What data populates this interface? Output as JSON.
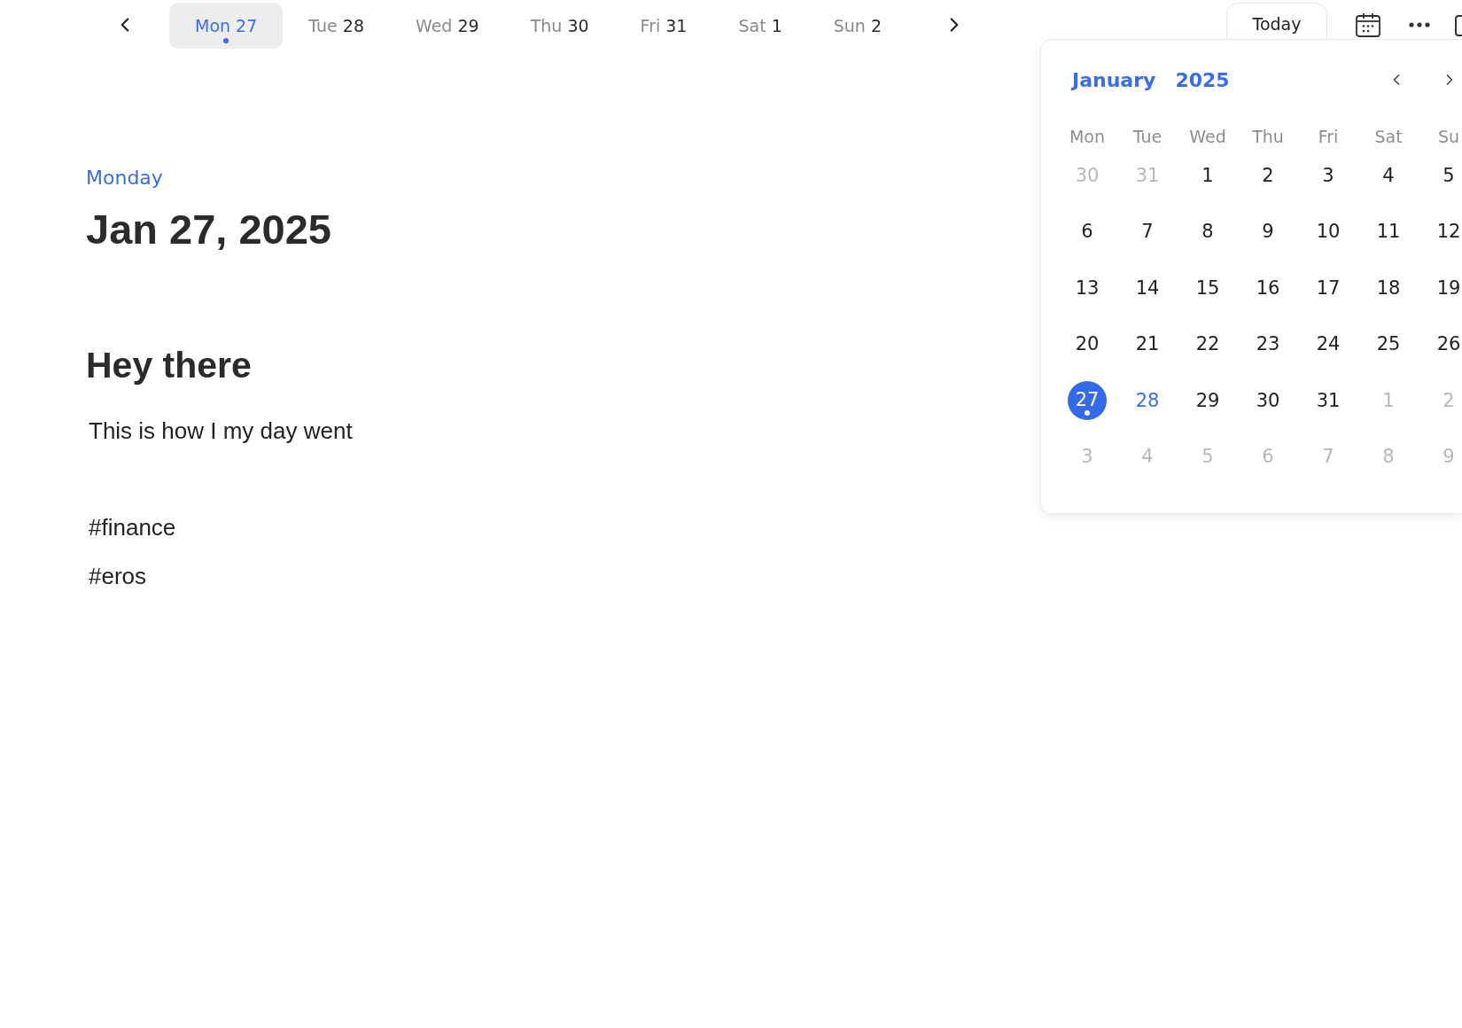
{
  "week_strip": {
    "days": [
      {
        "weekday": "Mon",
        "date": "27",
        "selected": true,
        "dot": true
      },
      {
        "weekday": "Tue",
        "date": "28",
        "selected": false,
        "dot": false
      },
      {
        "weekday": "Wed",
        "date": "29",
        "selected": false,
        "dot": false
      },
      {
        "weekday": "Thu",
        "date": "30",
        "selected": false,
        "dot": false
      },
      {
        "weekday": "Fri",
        "date": "31",
        "selected": false,
        "dot": false
      },
      {
        "weekday": "Sat",
        "date": "1",
        "selected": false,
        "dot": false
      },
      {
        "weekday": "Sun",
        "date": "2",
        "selected": false,
        "dot": false
      }
    ]
  },
  "toolbar": {
    "today_button": "Today"
  },
  "date_header": {
    "weekday": "Monday",
    "date": "Jan 27, 2025"
  },
  "entry": {
    "title": "Hey there",
    "body": "This is how I my day went",
    "tags": [
      "#finance",
      "#eros"
    ]
  },
  "date_picker": {
    "month": "January",
    "year": "2025",
    "weekday_headers": [
      "Mon",
      "Tue",
      "Wed",
      "Thu",
      "Fri",
      "Sat",
      "Su"
    ],
    "weeks": [
      [
        {
          "day": "30",
          "outside": true,
          "today": false,
          "selected": false,
          "dot": false
        },
        {
          "day": "31",
          "outside": true,
          "today": false,
          "selected": false,
          "dot": false
        },
        {
          "day": "1",
          "outside": false,
          "today": false,
          "selected": false,
          "dot": false
        },
        {
          "day": "2",
          "outside": false,
          "today": false,
          "selected": false,
          "dot": false
        },
        {
          "day": "3",
          "outside": false,
          "today": false,
          "selected": false,
          "dot": false
        },
        {
          "day": "4",
          "outside": false,
          "today": false,
          "selected": false,
          "dot": false
        },
        {
          "day": "5",
          "outside": false,
          "today": false,
          "selected": false,
          "dot": false
        }
      ],
      [
        {
          "day": "6",
          "outside": false,
          "today": false,
          "selected": false,
          "dot": false
        },
        {
          "day": "7",
          "outside": false,
          "today": false,
          "selected": false,
          "dot": false
        },
        {
          "day": "8",
          "outside": false,
          "today": false,
          "selected": false,
          "dot": false
        },
        {
          "day": "9",
          "outside": false,
          "today": false,
          "selected": false,
          "dot": false
        },
        {
          "day": "10",
          "outside": false,
          "today": false,
          "selected": false,
          "dot": false
        },
        {
          "day": "11",
          "outside": false,
          "today": false,
          "selected": false,
          "dot": false
        },
        {
          "day": "12",
          "outside": false,
          "today": false,
          "selected": false,
          "dot": false
        }
      ],
      [
        {
          "day": "13",
          "outside": false,
          "today": false,
          "selected": false,
          "dot": false
        },
        {
          "day": "14",
          "outside": false,
          "today": false,
          "selected": false,
          "dot": false
        },
        {
          "day": "15",
          "outside": false,
          "today": false,
          "selected": false,
          "dot": false
        },
        {
          "day": "16",
          "outside": false,
          "today": false,
          "selected": false,
          "dot": false
        },
        {
          "day": "17",
          "outside": false,
          "today": false,
          "selected": false,
          "dot": false
        },
        {
          "day": "18",
          "outside": false,
          "today": false,
          "selected": false,
          "dot": false
        },
        {
          "day": "19",
          "outside": false,
          "today": false,
          "selected": false,
          "dot": false
        }
      ],
      [
        {
          "day": "20",
          "outside": false,
          "today": false,
          "selected": false,
          "dot": false
        },
        {
          "day": "21",
          "outside": false,
          "today": false,
          "selected": false,
          "dot": false
        },
        {
          "day": "22",
          "outside": false,
          "today": false,
          "selected": false,
          "dot": false
        },
        {
          "day": "23",
          "outside": false,
          "today": false,
          "selected": false,
          "dot": false
        },
        {
          "day": "24",
          "outside": false,
          "today": false,
          "selected": false,
          "dot": false
        },
        {
          "day": "25",
          "outside": false,
          "today": false,
          "selected": false,
          "dot": false
        },
        {
          "day": "26",
          "outside": false,
          "today": false,
          "selected": false,
          "dot": false
        }
      ],
      [
        {
          "day": "27",
          "outside": false,
          "today": false,
          "selected": true,
          "dot": true
        },
        {
          "day": "28",
          "outside": false,
          "today": true,
          "selected": false,
          "dot": false
        },
        {
          "day": "29",
          "outside": false,
          "today": false,
          "selected": false,
          "dot": false
        },
        {
          "day": "30",
          "outside": false,
          "today": false,
          "selected": false,
          "dot": false
        },
        {
          "day": "31",
          "outside": false,
          "today": false,
          "selected": false,
          "dot": false
        },
        {
          "day": "1",
          "outside": true,
          "today": false,
          "selected": false,
          "dot": false
        },
        {
          "day": "2",
          "outside": true,
          "today": false,
          "selected": false,
          "dot": false
        }
      ],
      [
        {
          "day": "3",
          "outside": true,
          "today": false,
          "selected": false,
          "dot": false
        },
        {
          "day": "4",
          "outside": true,
          "today": false,
          "selected": false,
          "dot": false
        },
        {
          "day": "5",
          "outside": true,
          "today": false,
          "selected": false,
          "dot": false
        },
        {
          "day": "6",
          "outside": true,
          "today": false,
          "selected": false,
          "dot": false
        },
        {
          "day": "7",
          "outside": true,
          "today": false,
          "selected": false,
          "dot": false
        },
        {
          "day": "8",
          "outside": true,
          "today": false,
          "selected": false,
          "dot": false
        },
        {
          "day": "9",
          "outside": true,
          "today": false,
          "selected": false,
          "dot": false
        }
      ]
    ]
  }
}
